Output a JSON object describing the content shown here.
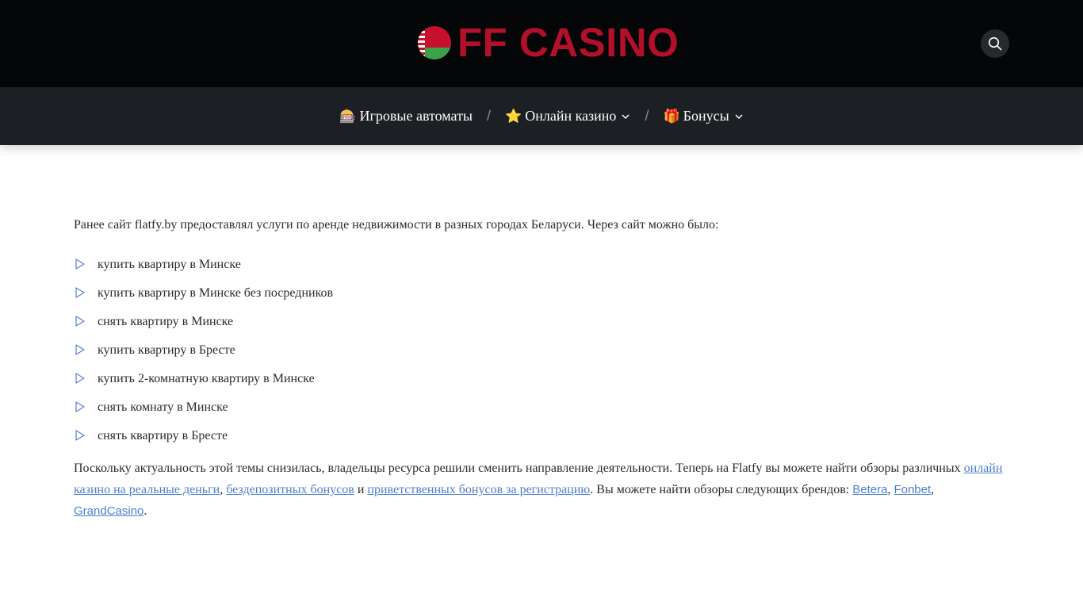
{
  "header": {
    "logo_text": "FF CASINO",
    "search_icon": "search-icon",
    "colors": {
      "topbar": "#050608",
      "navbar": "#1c1f23",
      "logo": "#b3102a",
      "link": "#4a7fd1"
    }
  },
  "nav": {
    "items": [
      {
        "emoji": "🎰",
        "label": "Игровые автоматы",
        "has_dropdown": false
      },
      {
        "emoji": "⭐",
        "label": "Онлайн казино",
        "has_dropdown": true
      },
      {
        "emoji": "🎁",
        "label": "Бонусы",
        "has_dropdown": true
      }
    ],
    "separator": "/"
  },
  "content": {
    "intro": "Ранее сайт flatfy.by предоставлял услуги по аренде недвижимости в разных городах Беларуси. Через сайт можно было:",
    "list": [
      "купить квартиру в Минске",
      "купить квартиру в Минске без посредников",
      "снять квартиру в Минске",
      "купить квартиру в Бресте",
      "купить 2-комнатную квартиру в Минске",
      "снять комнату в Минске",
      "снять квартиру в Бресте"
    ],
    "para2": {
      "text1": "Поскольку актуальность этой темы снизилась, владельцы ресурса решили сменить направление деятельности. Теперь на Flatfy вы можете найти обзоры различных ",
      "link1": "онлайн казино на реальные деньги",
      "text2": ", ",
      "link2": "бездепозитных бонусов",
      "text3": " и ",
      "link3": "приветственных бонусов за регистрацию",
      "text4": ". Вы можете найти обзоры следующих брендов: ",
      "brand1": "Betera",
      "sep1": ", ",
      "brand2": "Fonbet",
      "sep2": ", ",
      "brand3": "GrandCasino",
      "end": "."
    }
  }
}
